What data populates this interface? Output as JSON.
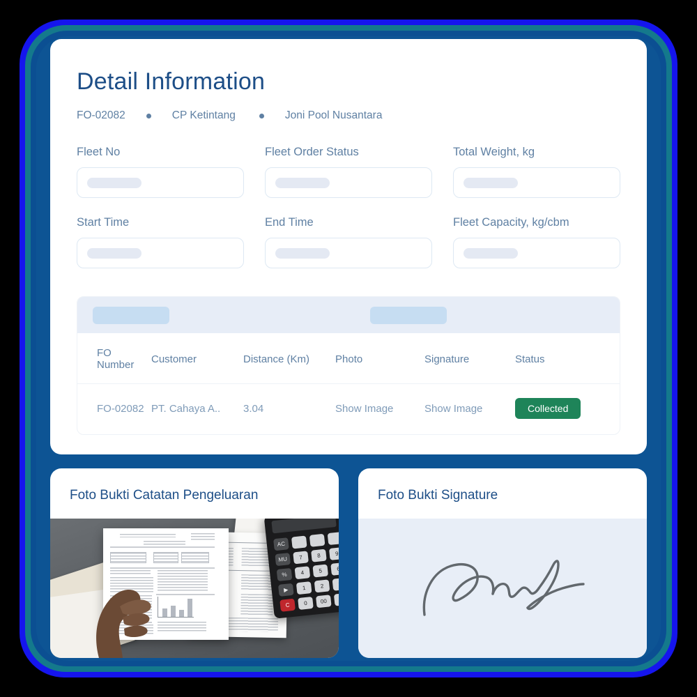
{
  "header": {
    "title": "Detail Information",
    "breadcrumb": [
      "FO-02082",
      "CP Ketintang",
      "Joni Pool Nusantara"
    ]
  },
  "form": {
    "fields": [
      {
        "label": "Fleet No",
        "value": ""
      },
      {
        "label": "Fleet Order Status",
        "value": ""
      },
      {
        "label": "Total Weight, kg",
        "value": ""
      },
      {
        "label": "Start Time",
        "value": ""
      },
      {
        "label": "End Time",
        "value": ""
      },
      {
        "label": "Fleet Capacity, kg/cbm",
        "value": ""
      }
    ]
  },
  "table": {
    "columns": [
      "FO Number",
      "Customer",
      "Distance (Km)",
      "Photo",
      "Signature",
      "Status"
    ],
    "rows": [
      {
        "fo_number": "FO-02082",
        "customer": "PT. Cahaya A..",
        "distance": "3.04",
        "photo_link": "Show Image",
        "signature_link": "Show Image",
        "status": "Collected"
      }
    ]
  },
  "photo_cards": [
    {
      "title": "Foto Bukti Catatan Pengeluaran"
    },
    {
      "title": "Foto Bukti Signature"
    }
  ],
  "colors": {
    "title_blue": "#1d4e87",
    "label_blue": "#5f80a3",
    "link_blue": "#1f4f87",
    "badge_green": "#1e8459",
    "frame_bright_blue": "#1515ee",
    "frame_teal": "#14798c",
    "frame_dark_blue": "#0d5494",
    "toolbar_bg": "#e7edf7",
    "skeleton": "#e4e9f3",
    "signature_bg": "#e8eef7"
  }
}
